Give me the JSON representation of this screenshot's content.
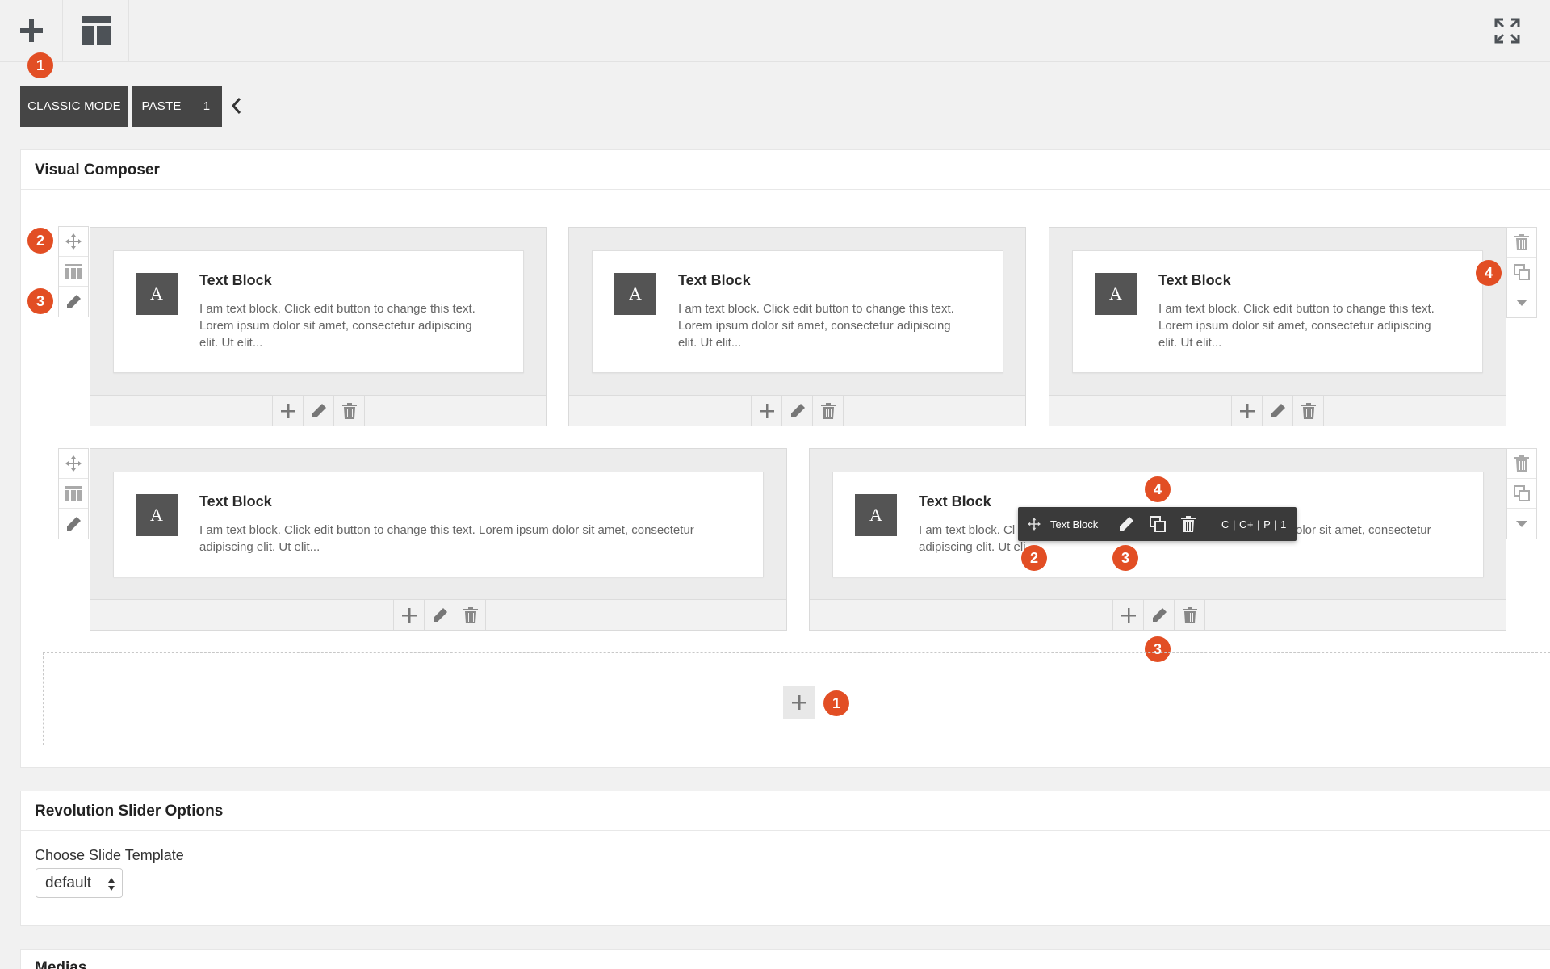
{
  "toolbar": {
    "add_icon": "plus-icon",
    "layout_icon": "layout-icon",
    "fullscreen_icon": "fullscreen-icon"
  },
  "action_buttons": {
    "classic_mode": "CLASSIC MODE",
    "paste": "PASTE",
    "paste_count": "1"
  },
  "visual_composer": {
    "title": "Visual Composer",
    "text_block_title": "Text Block",
    "rows": [
      {
        "columns": [
          {
            "title": "Text Block",
            "desc_lines": [
              "I am text block. Click edit button to change this text.",
              "Lorem ipsum dolor sit amet, consectetur adipiscing",
              "elit. Ut elit..."
            ]
          },
          {
            "title": "Text Block",
            "desc_lines": [
              "I am text block. Click edit button to change this text.",
              "Lorem ipsum dolor sit amet, consectetur adipiscing",
              "elit. Ut elit..."
            ]
          },
          {
            "title": "Text Block",
            "desc_lines": [
              "I am text block. Click edit button to change this text.",
              "Lorem ipsum dolor sit amet, consectetur adipiscing",
              "elit. Ut elit..."
            ]
          }
        ]
      },
      {
        "columns": [
          {
            "title": "Text Block",
            "desc_lines": [
              "I am text block. Click edit button to change this text. Lorem ipsum dolor sit amet, consectetur",
              "adipiscing elit. Ut elit..."
            ]
          },
          {
            "title": "Text Block",
            "desc_left_lines": [
              "I am text block. Cl",
              "adipiscing elit. Ut eli"
            ],
            "desc_right": "olor sit amet, consectetur"
          }
        ]
      }
    ],
    "hover_toolbar": {
      "label": "Text Block",
      "shortcut": "C | C+ | P | 1"
    }
  },
  "badges": [
    "1",
    "2",
    "3",
    "4"
  ],
  "revolution_slider": {
    "title": "Revolution Slider Options",
    "choose_label": "Choose Slide Template",
    "select_value": "default"
  },
  "medias": {
    "title": "Medias"
  },
  "colors": {
    "badge": "#e24e24",
    "dark_button": "#454545",
    "page_bg": "#f1f1f1"
  }
}
